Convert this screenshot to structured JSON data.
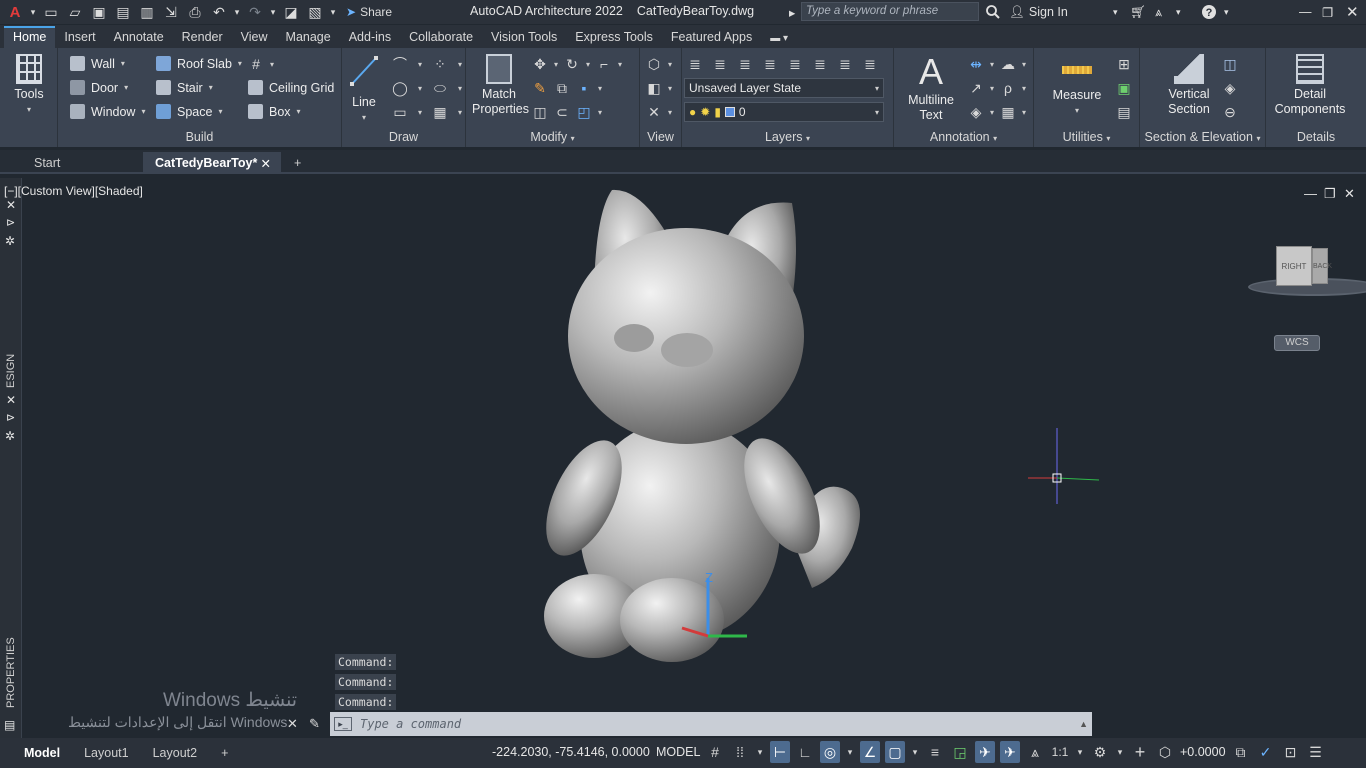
{
  "app": {
    "name": "AutoCAD Architecture 2022",
    "file": "CatTedyBearToy.dwg",
    "share_label": "Share",
    "search_placeholder": "Type a keyword or phrase",
    "sign_in": "Sign In"
  },
  "ribbon_tabs": [
    "Home",
    "Insert",
    "Annotate",
    "Render",
    "View",
    "Manage",
    "Add-ins",
    "Collaborate",
    "Vision Tools",
    "Express Tools",
    "Featured Apps"
  ],
  "active_tab": "Home",
  "ribbon": {
    "tools": {
      "label": "Tools"
    },
    "build": {
      "title": "Build",
      "items": [
        "Wall",
        "Door",
        "Window",
        "Roof Slab",
        "Stair",
        "Space",
        "Ceiling Grid",
        "Box"
      ]
    },
    "draw": {
      "title": "Draw",
      "line_label": "Line"
    },
    "modify": {
      "title": "Modify",
      "match_properties": [
        "Match",
        "Properties"
      ]
    },
    "view": {
      "title": "View"
    },
    "layers": {
      "title": "Layers",
      "layer_state": "Unsaved Layer State",
      "current_layer": "0"
    },
    "annotation": {
      "title": "Annotation",
      "multiline_text": [
        "Multiline",
        "Text"
      ]
    },
    "utilities": {
      "title": "Utilities",
      "measure": "Measure"
    },
    "section": {
      "title": "Section & Elevation",
      "vertical_section": [
        "Vertical",
        "Section"
      ]
    },
    "details": {
      "title": "Details",
      "detail_components": [
        "Detail",
        "Components"
      ]
    }
  },
  "doc_tabs": {
    "start": "Start",
    "current": "CatTedyBearToy*"
  },
  "viewport": {
    "label": "[−][Custom View][Shaded]",
    "viewcube_right": "RIGHT",
    "viewcube_back": "BACK",
    "wcs": "WCS",
    "axis_z": "Z"
  },
  "side_palettes": {
    "design": "ESIGN",
    "properties": "PROPERTIES"
  },
  "command_history": [
    "Command:",
    "Command:",
    "Command:"
  ],
  "command_prompt": "Type a command",
  "watermark": {
    "line1": "Windows تنشيط",
    "line2": "انتقل إلى الإعدادات لتنشيط Windows."
  },
  "status": {
    "layout_tabs": [
      "Model",
      "Layout1",
      "Layout2"
    ],
    "coordinates": "-224.2030, -75.4146, 0.0000",
    "space": "MODEL",
    "scale": "1:1",
    "value": "+0.0000"
  }
}
